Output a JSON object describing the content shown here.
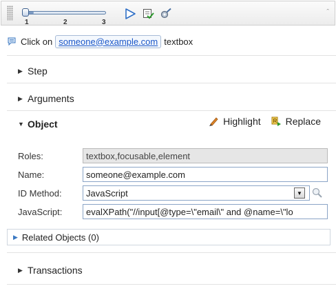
{
  "toolbar": {
    "slider_ticks": [
      "1",
      "2",
      "3"
    ],
    "slider_level": 0.1,
    "play_icon": "play-icon",
    "checklist_icon": "checklist-icon",
    "settings_icon": "settings-search-icon",
    "collapse_icon": "double-chevron-up-icon"
  },
  "step_description": {
    "prefix": "Click on",
    "link": "someone@example.com",
    "suffix": "textbox"
  },
  "sections": {
    "step": "Step",
    "arguments": "Arguments",
    "object": "Object",
    "transactions": "Transactions"
  },
  "object_actions": {
    "highlight": "Highlight",
    "replace": "Replace"
  },
  "form": {
    "roles_label": "Roles:",
    "roles_value": "textbox,focusable,element",
    "name_label": "Name:",
    "name_value": "someone@example.com",
    "id_method_label": "ID Method:",
    "id_method_value": "JavaScript",
    "javascript_label": "JavaScript:",
    "javascript_value": "evalXPath(\"//input[@type=\\\"email\\\" and @name=\\\"lo"
  },
  "related_objects": "Related Objects (0)",
  "colors": {
    "link": "#1a56c8",
    "accent": "#3b78c2",
    "field_border": "#8aa4c6"
  }
}
